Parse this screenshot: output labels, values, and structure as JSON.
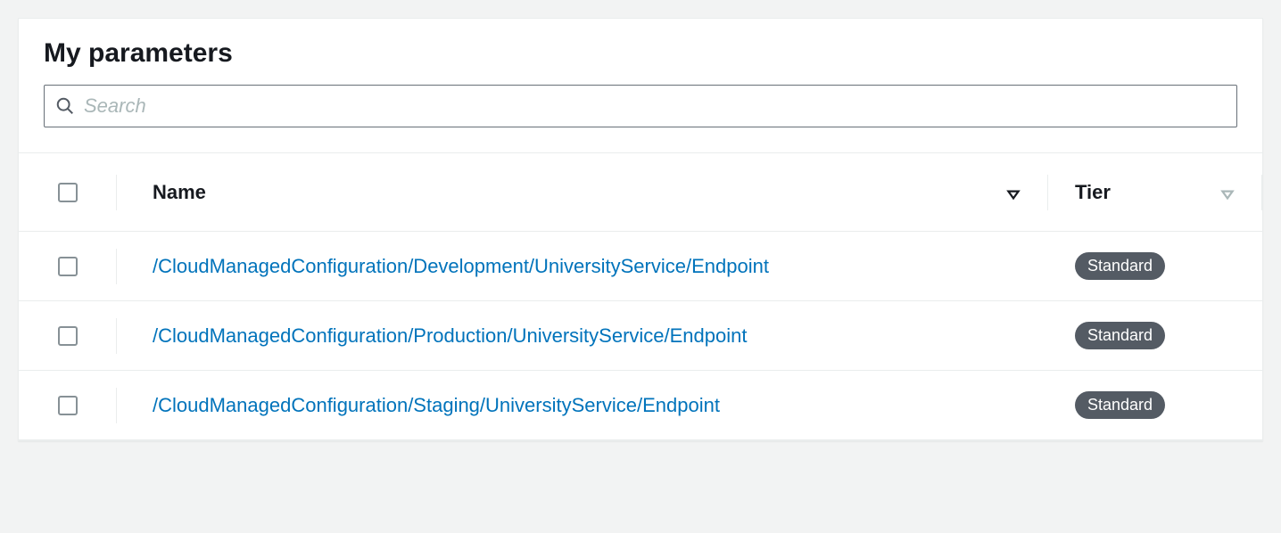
{
  "header": {
    "title": "My parameters"
  },
  "search": {
    "placeholder": "Search",
    "value": ""
  },
  "columns": {
    "name": "Name",
    "tier": "Tier"
  },
  "rows": [
    {
      "name": "/CloudManagedConfiguration/Development/UniversityService/Endpoint",
      "tier": "Standard"
    },
    {
      "name": "/CloudManagedConfiguration/Production/UniversityService/Endpoint",
      "tier": "Standard"
    },
    {
      "name": "/CloudManagedConfiguration/Staging/UniversityService/Endpoint",
      "tier": "Standard"
    }
  ]
}
